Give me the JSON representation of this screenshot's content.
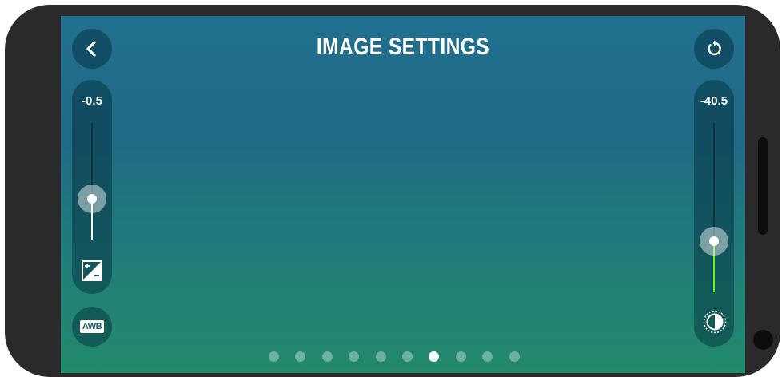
{
  "header": {
    "title": "IMAGE SETTINGS",
    "back_icon": "chevron-left-icon",
    "reset_icon": "refresh-icon"
  },
  "exposure_slider": {
    "value_label": "-0.5",
    "level_fraction": 0.35,
    "icon": "exposure-plus-minus-icon",
    "fill_color": "#ffffff"
  },
  "contrast_slider": {
    "value_label": "-40.5",
    "level_fraction": 0.3,
    "icon": "contrast-icon",
    "fill_color": "#6cf02a"
  },
  "awb_button": {
    "label": "AWB"
  },
  "pager": {
    "count": 10,
    "active_index": 6
  },
  "colors": {
    "frame": "#2a2a2a",
    "gradient_top": "#21708f",
    "gradient_bottom": "#22896b",
    "control_bg": "rgba(0,40,55,0.45)"
  }
}
